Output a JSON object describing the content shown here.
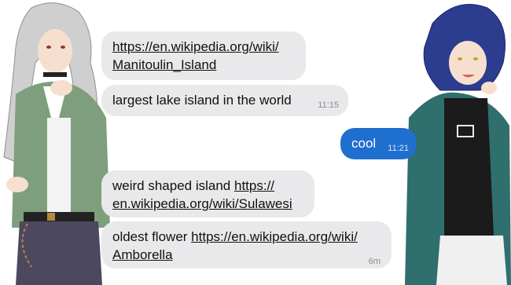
{
  "messages": [
    {
      "direction": "incoming",
      "prefix": "",
      "link_line1": "https://en.wikipedia.org/wiki/",
      "link_line2": "Manitoulin_Island",
      "time": ""
    },
    {
      "direction": "incoming",
      "text": "largest lake island in the world",
      "time": "11:15"
    },
    {
      "direction": "outgoing",
      "text": "cool",
      "time": "11:21"
    },
    {
      "direction": "incoming",
      "prefix": "weird shaped island ",
      "link_line1": "https://",
      "link_line2": "en.wikipedia.org/wiki/Sulawesi",
      "time": ""
    },
    {
      "direction": "incoming",
      "prefix": "oldest flower ",
      "link_line1": "https://en.wikipedia.org/wiki/",
      "link_line2": "Amborella",
      "time": "6m"
    }
  ],
  "colors": {
    "incoming_bubble": "#e9e9eb",
    "outgoing_bubble": "#1f6fcf",
    "timestamp": "#8a8a8e"
  },
  "icons": {
    "left_character": "silver-haired-anime-character-illustration",
    "right_character": "blue-haired-anime-character-illustration"
  }
}
